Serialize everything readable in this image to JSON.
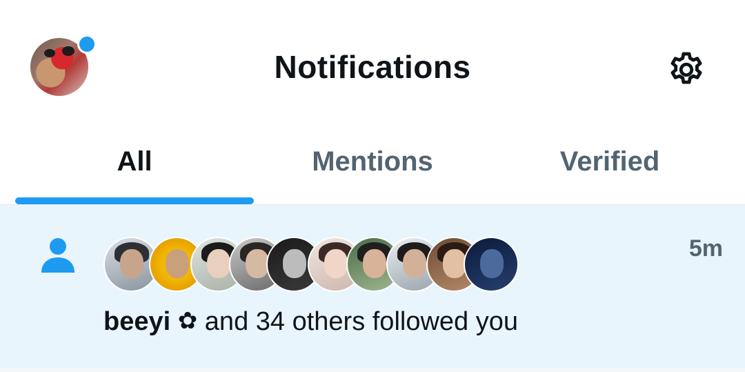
{
  "header": {
    "title": "Notifications",
    "avatar_icon": "profile-avatar",
    "status_dot_color": "#1d9bf0",
    "settings_icon": "gear-icon"
  },
  "tabs": [
    {
      "label": "All",
      "active": true
    },
    {
      "label": "Mentions",
      "active": false
    },
    {
      "label": "Verified",
      "active": false
    }
  ],
  "accent_color": "#1d9bf0",
  "notification": {
    "type_icon": "person-icon",
    "time": "5m",
    "actor": "beeyi",
    "actor_glyph": "✿",
    "text": "and 34 others followed you",
    "avatar_count": 10,
    "highlight_bg": "#e8f5fd"
  }
}
